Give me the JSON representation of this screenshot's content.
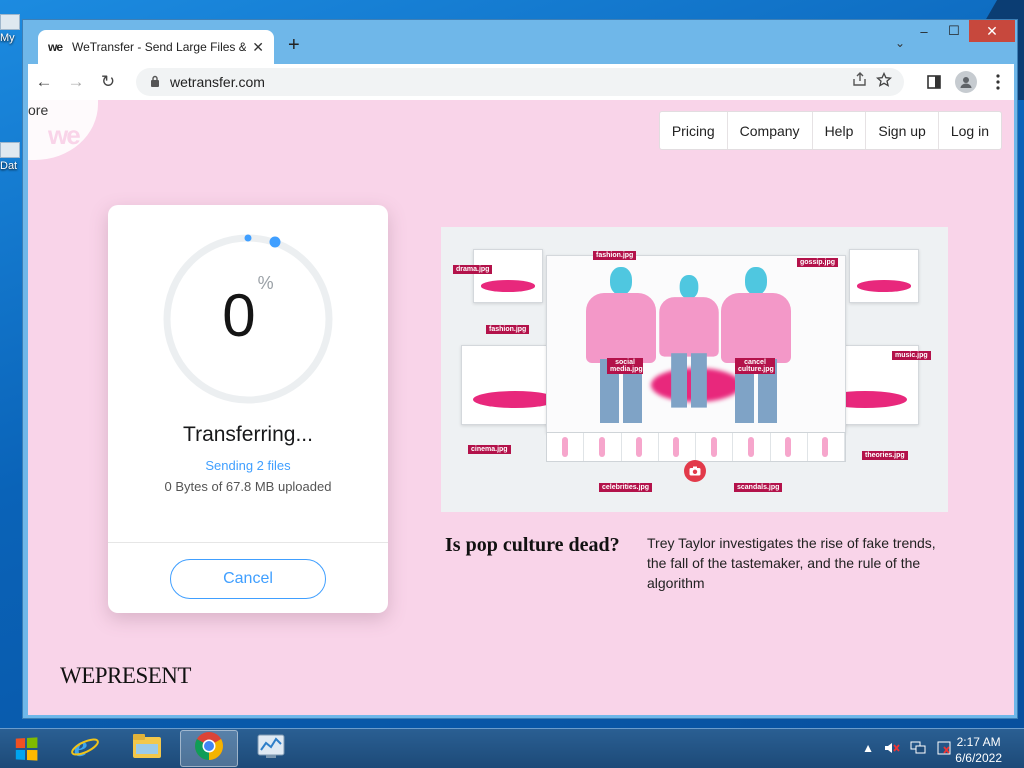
{
  "desktop": {
    "icons": [
      {
        "label": "My",
        "icon": "computer-icon"
      },
      {
        "label": "Dat",
        "icon": "file-icon"
      }
    ]
  },
  "browser": {
    "tab": {
      "favicon": "we",
      "title": "WeTransfer - Send Large Files & ",
      "close": "✕"
    },
    "new_tab": "+",
    "tab_list": "⌄",
    "window_controls": {
      "minimize": "–",
      "maximize": "☐",
      "close": "✕"
    },
    "nav": {
      "back": "←",
      "forward": "→",
      "reload": "↻"
    },
    "url": "wetransfer.com",
    "toolbar_icons": [
      "share-icon",
      "star-icon",
      "side-panel-icon",
      "profile-icon",
      "menu-icon"
    ]
  },
  "page": {
    "partial_text": "ore",
    "logo_text": "we",
    "nav_links": [
      "Pricing",
      "Company",
      "Help",
      "Sign up",
      "Log in"
    ],
    "transfer": {
      "percent": "0",
      "percent_sign": "%",
      "progress_fraction": 0.0,
      "status": "Transferring...",
      "sending": "Sending 2 files",
      "uploaded": "0 Bytes of 67.8 MB uploaded",
      "cancel_label": "Cancel"
    },
    "brand": "WEPRESENT",
    "ad": {
      "title": "Is pop culture dead?",
      "description": "Trey Taylor investigates the rise of fake trends, the fall of the tastemaker, and the rule of the algorithm",
      "tags": [
        "drama.jpg",
        "fashion.jpg",
        "cinema.jpg",
        "gossip.jpg",
        "music.jpg",
        "theories.jpg",
        "social media.jpg",
        "cancel culture.jpg",
        "celebrities.jpg",
        "scandals.jpg",
        "fashion.jpg"
      ]
    }
  },
  "taskbar": {
    "apps": [
      "start-button",
      "internet-explorer-icon",
      "file-explorer-icon",
      "chrome-icon",
      "control-panel-icon"
    ],
    "time": "2:17 AM",
    "date": "6/6/2022",
    "tray_icons": [
      "show-hidden-icons",
      "volume-muted-icon",
      "network-icon",
      "action-center-icon"
    ]
  }
}
